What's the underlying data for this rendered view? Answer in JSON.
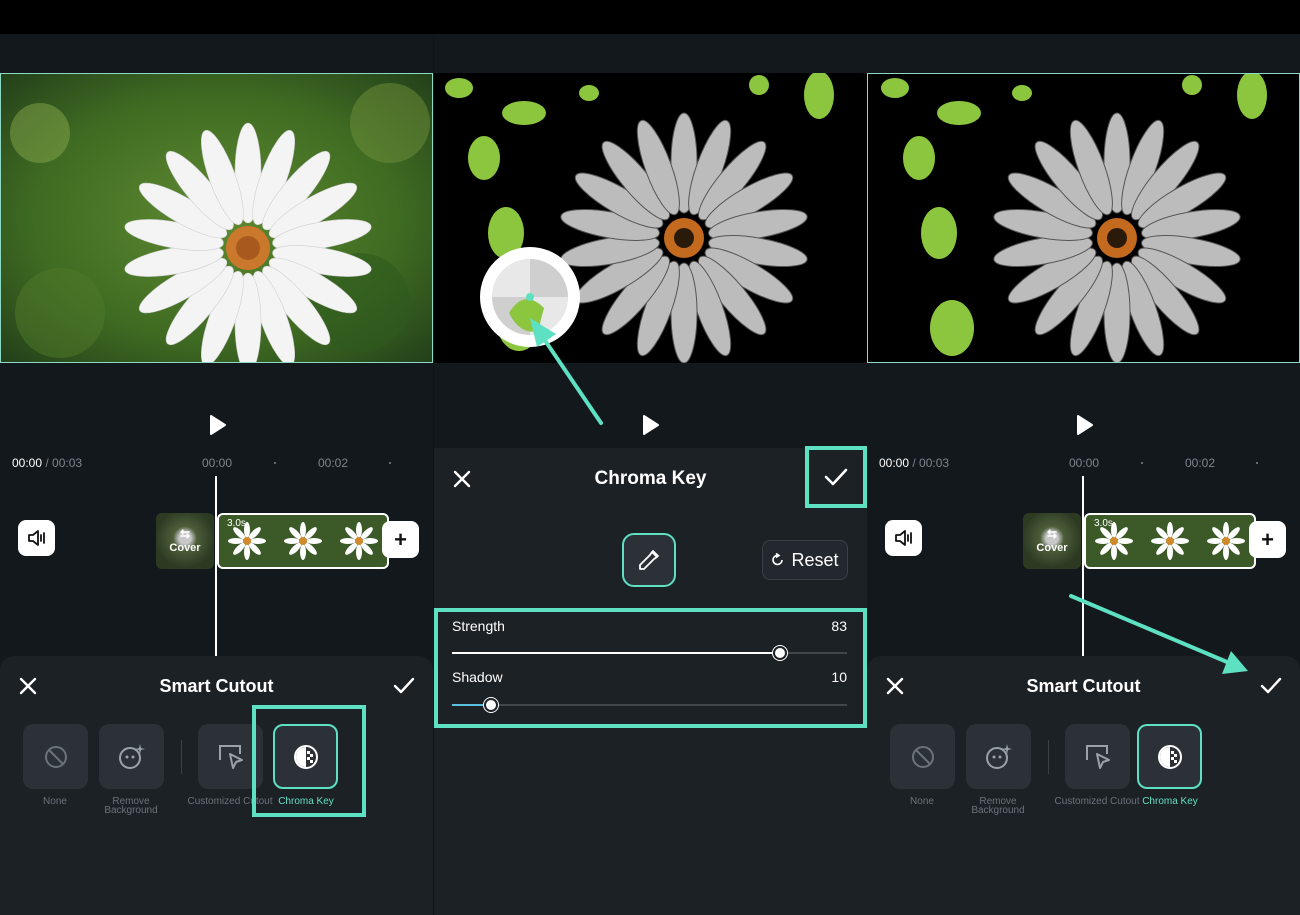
{
  "panels": [
    {
      "timecode_current": "00:00",
      "timecode_total": "/ 00:03",
      "ruler": [
        "00:00",
        "00:02"
      ],
      "clip_duration": "3.0s",
      "cover_label": "Cover",
      "sheet": {
        "title": "Smart Cutout",
        "tools": [
          {
            "label": "None",
            "icon": "ban-icon"
          },
          {
            "label": "Remove Background",
            "icon": "magic-face-icon"
          },
          {
            "label": "Customized Cutout",
            "icon": "cursor-select-icon"
          },
          {
            "label": "Chroma Key",
            "icon": "chroma-key-icon",
            "selected": true
          }
        ]
      }
    },
    {
      "sheet": {
        "title": "Chroma Key",
        "reset_label": "Reset",
        "sliders": [
          {
            "label": "Strength",
            "value": "83"
          },
          {
            "label": "Shadow",
            "value": "10"
          }
        ]
      }
    },
    {
      "timecode_current": "00:00",
      "timecode_total": "/ 00:03",
      "ruler": [
        "00:00",
        "00:02"
      ],
      "clip_duration": "3.0s",
      "cover_label": "Cover",
      "sheet": {
        "title": "Smart Cutout",
        "tools": [
          {
            "label": "None",
            "icon": "ban-icon"
          },
          {
            "label": "Remove Background",
            "icon": "magic-face-icon"
          },
          {
            "label": "Customized Cutout",
            "icon": "cursor-select-icon"
          },
          {
            "label": "Chroma Key",
            "icon": "chroma-key-icon",
            "selected": true
          }
        ]
      }
    }
  ],
  "colors": {
    "accent": "#5ee0c2",
    "sheet_bg": "#1c2126",
    "panel_bg": "#13181c",
    "shadow_slider": "#5bc0de"
  }
}
